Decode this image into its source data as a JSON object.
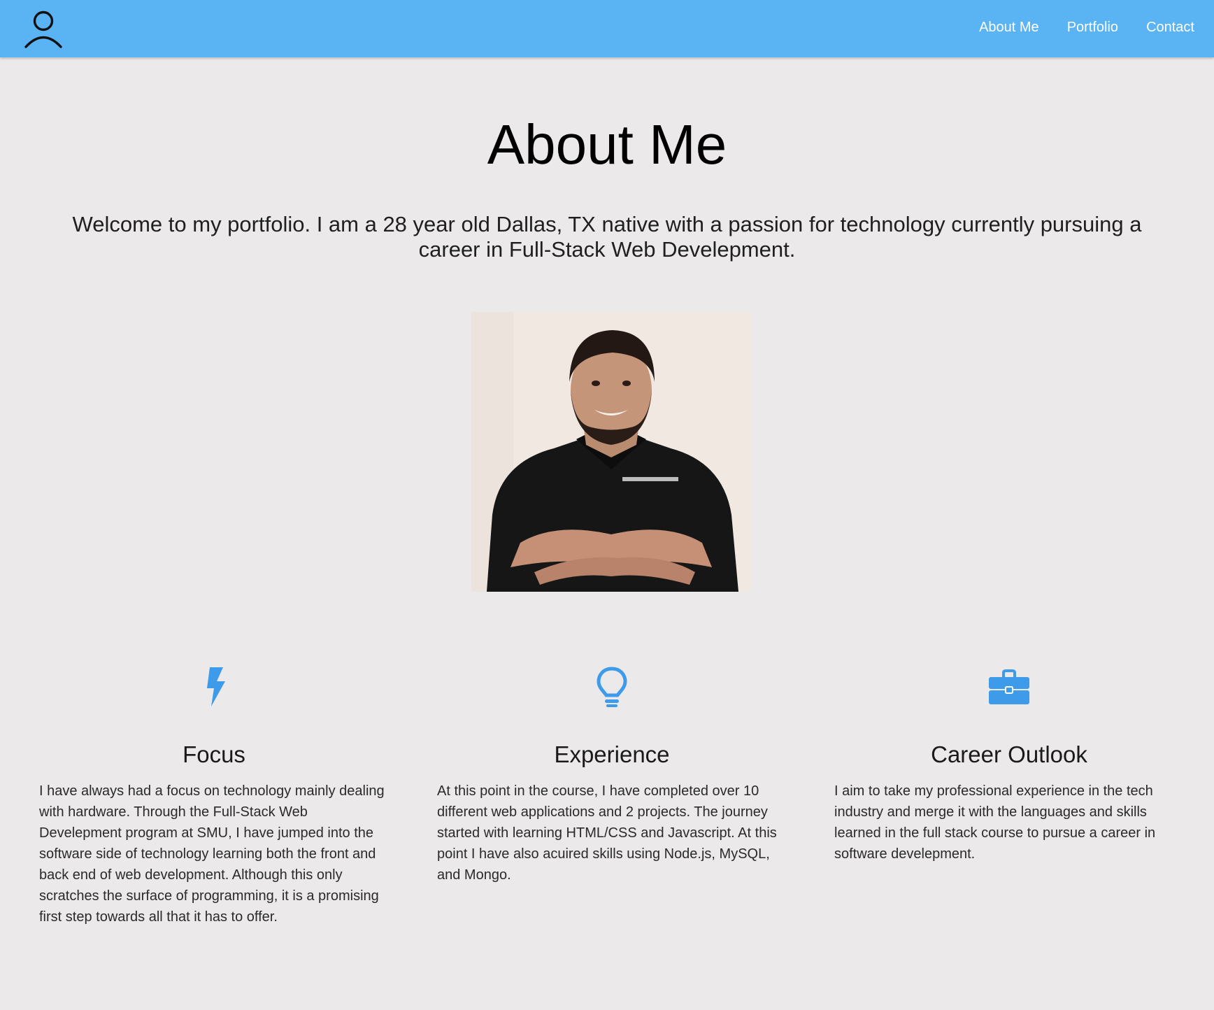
{
  "nav": {
    "brand_icon": "user-outline-icon",
    "links": [
      "About Me",
      "Portfolio",
      "Contact"
    ],
    "bg_color": "#5ab3f2"
  },
  "page": {
    "title": "About Me",
    "intro": "Welcome to my portfolio. I am a 28 year old Dallas, TX native with a passion for technology currently pursuing a career in Full-Stack Web Develepment.",
    "portrait_icon": "profile-photo",
    "accent_color": "#3d9be9"
  },
  "columns": [
    {
      "icon": "lightning-bolt-icon",
      "title": "Focus",
      "text": "I have always had a focus on technology mainly dealing with hardware. Through the Full-Stack Web Develepment program at SMU, I have jumped into the software side of technology learning both the front and back end of web development. Although this only scratches the surface of programming, it is a promising first step towards all that it has to offer."
    },
    {
      "icon": "lightbulb-icon",
      "title": "Experience",
      "text": "At this point in the course, I have completed over 10 different web applications and 2 projects. The journey started with learning HTML/CSS and Javascript. At this point I have also acuired skills using Node.js, MySQL, and Mongo."
    },
    {
      "icon": "briefcase-icon",
      "title": "Career Outlook",
      "text": "I aim to take my professional experience in the tech industry and merge it with the languages and skills learned in the full stack course to pursue a career in software develepment."
    }
  ]
}
